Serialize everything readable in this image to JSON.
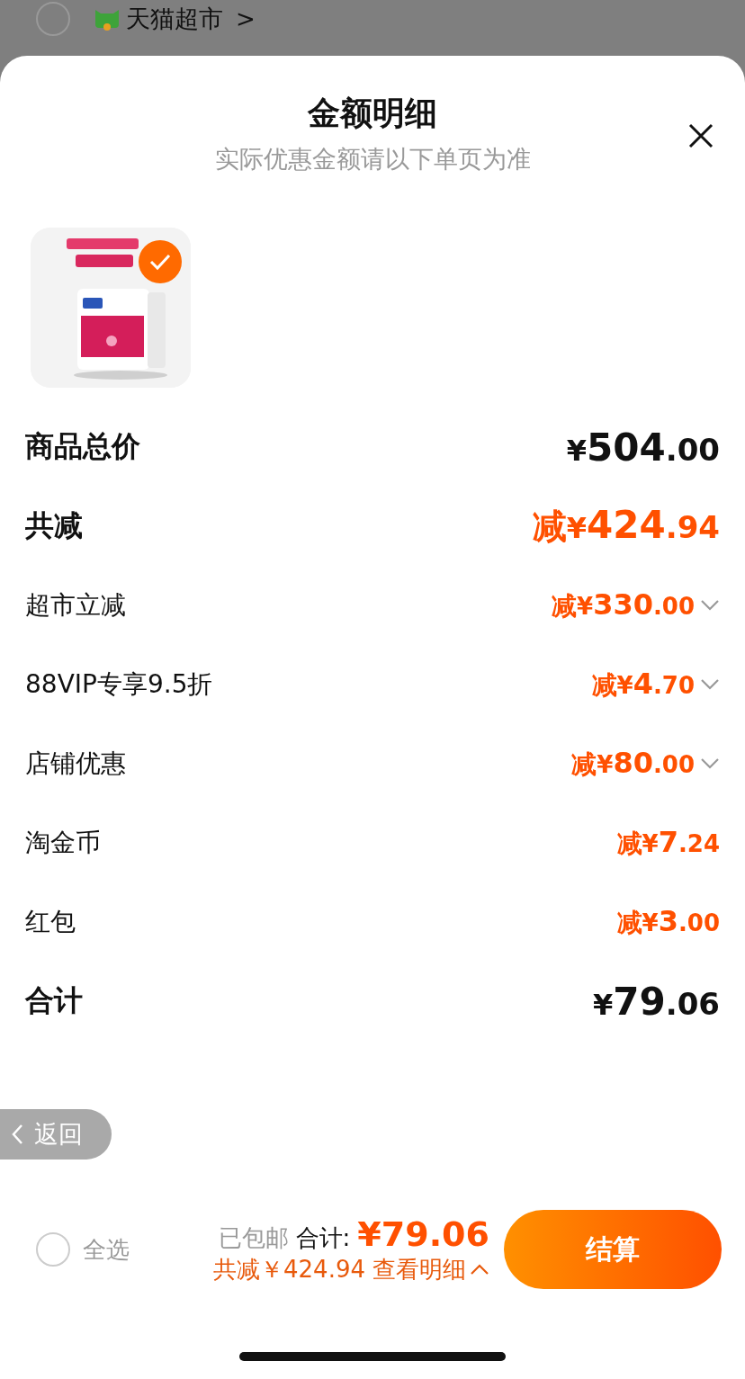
{
  "store": {
    "name": "天猫超市",
    "arrow": ">",
    "selected": false
  },
  "sheet": {
    "title": "金额明细",
    "subtitle": "实际优惠金额请以下单页为准",
    "product": {
      "kind": "picture",
      "selected": true
    },
    "rows": [
      {
        "kind": "total",
        "label": "商品总价",
        "currency": "¥",
        "integer": "504",
        "fraction": ".00",
        "expandable": false
      },
      {
        "kind": "discount_total",
        "label": "共减",
        "prefix": "减",
        "currency": "¥",
        "integer": "424",
        "fraction": ".94",
        "expandable": false
      },
      {
        "kind": "discount",
        "label": "超市立减",
        "prefix": "减",
        "currency": "¥",
        "integer": "330",
        "fraction": ".00",
        "expandable": true
      },
      {
        "kind": "discount",
        "label": "88VIP专享9.5折",
        "prefix": "减",
        "currency": "¥",
        "integer": "4",
        "fraction": ".70",
        "expandable": true
      },
      {
        "kind": "discount",
        "label": "店铺优惠",
        "prefix": "减",
        "currency": "¥",
        "integer": "80",
        "fraction": ".00",
        "expandable": true
      },
      {
        "kind": "discount",
        "label": "淘金币",
        "prefix": "减",
        "currency": "¥",
        "integer": "7",
        "fraction": ".24",
        "expandable": false
      },
      {
        "kind": "discount",
        "label": "红包",
        "prefix": "减",
        "currency": "¥",
        "integer": "3",
        "fraction": ".00",
        "expandable": false
      },
      {
        "kind": "total",
        "label": "合计",
        "currency": "¥",
        "integer": "79",
        "fraction": ".06",
        "expandable": false
      }
    ]
  },
  "back_button": {
    "label": "返回"
  },
  "footer": {
    "select_all": {
      "label": "全选",
      "selected": false
    },
    "shipping": "已包邮",
    "total_label": "合计:",
    "total": "¥79.06",
    "discount": "共减￥424.94",
    "details_link": "查看明细",
    "checkout": "结算"
  }
}
